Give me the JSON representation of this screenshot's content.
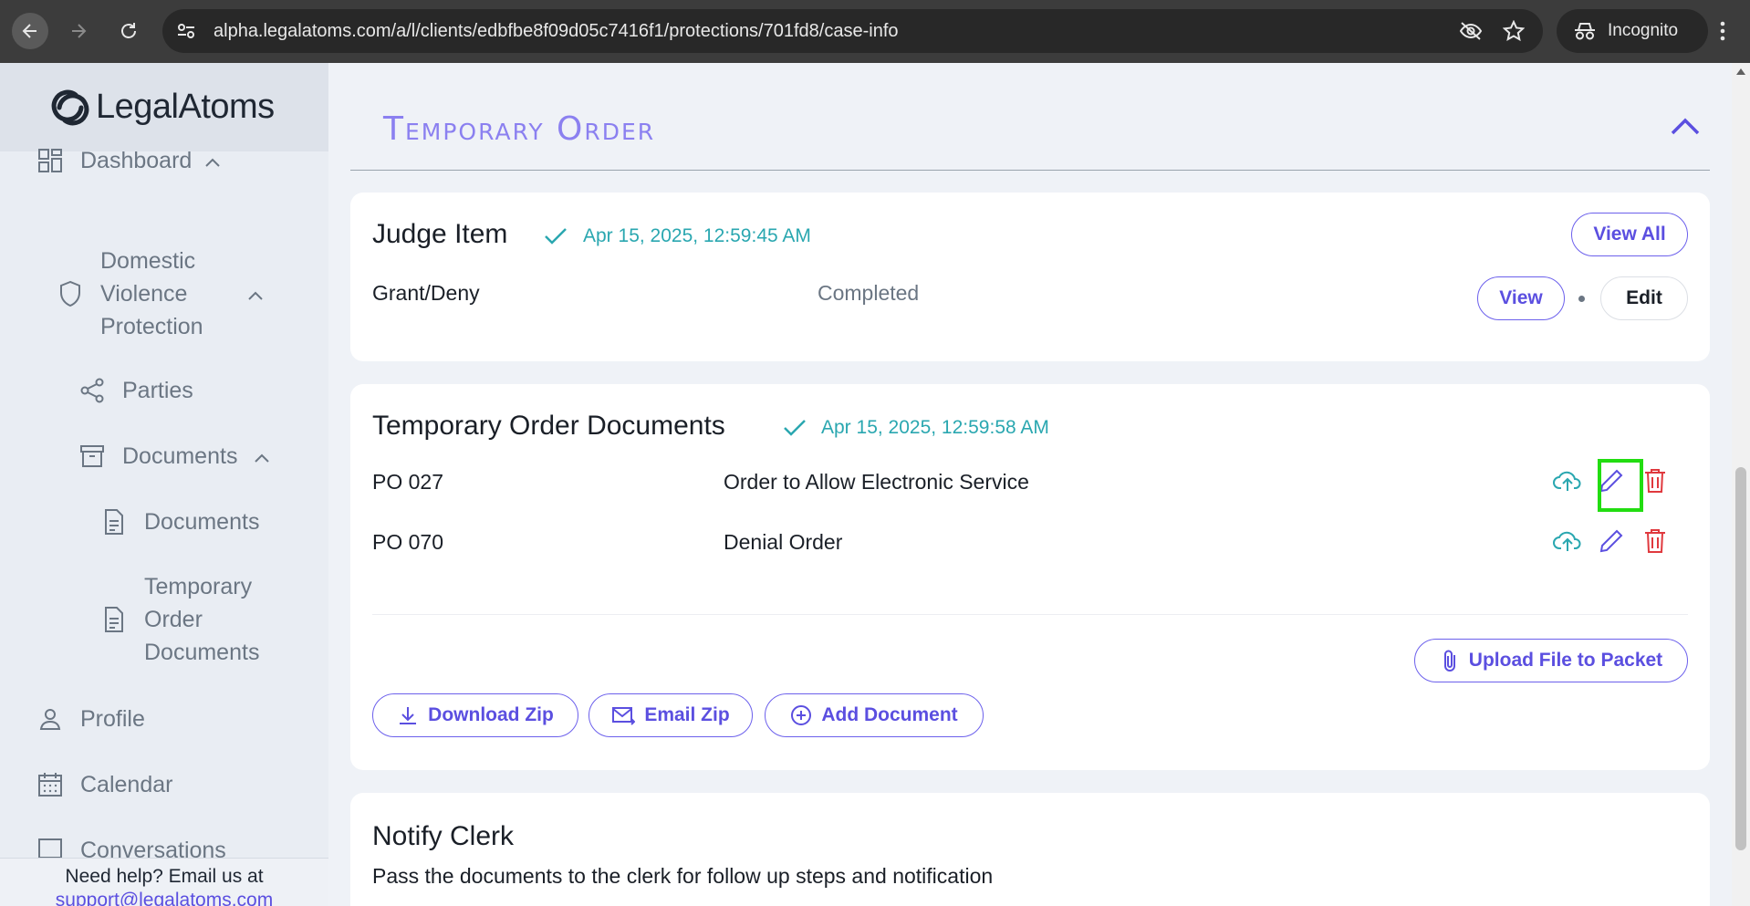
{
  "browser": {
    "url": "alpha.legalatoms.com/a/l/clients/edbfbe8f09d05c7416f1/protections/701fd8/case-info",
    "incognito_label": "Incognito"
  },
  "sidebar": {
    "logo_light": "Legal",
    "logo_bold": "Atoms",
    "items": [
      {
        "label": "Dashboard"
      },
      {
        "label_lines": [
          "Domestic",
          "Violence",
          "Protection"
        ]
      },
      {
        "label": "Parties"
      },
      {
        "label": "Documents"
      },
      {
        "label": "Documents"
      },
      {
        "label_lines": [
          "Temporary",
          "Order",
          "Documents"
        ]
      },
      {
        "label": "Profile"
      },
      {
        "label": "Calendar"
      },
      {
        "label": "Conversations"
      }
    ],
    "help_text": "Need help? Email us at",
    "help_email": "support@legalatoms.com"
  },
  "main": {
    "section_title": "Temporary Order",
    "judge_card": {
      "title": "Judge Item",
      "timestamp": "Apr 15, 2025, 12:59:45 AM",
      "view_all_label": "View All",
      "row_label": "Grant/Deny",
      "row_status": "Completed",
      "view_label": "View",
      "edit_label": "Edit"
    },
    "docs_card": {
      "title": "Temporary Order Documents",
      "timestamp": "Apr 15, 2025, 12:59:58 AM",
      "rows": [
        {
          "code": "PO 027",
          "name": "Order to Allow Electronic Service"
        },
        {
          "code": "PO 070",
          "name": "Denial Order"
        }
      ],
      "upload_label": "Upload File to Packet",
      "download_zip_label": "Download Zip",
      "email_zip_label": "Email Zip",
      "add_document_label": "Add Document"
    },
    "notify_card": {
      "title": "Notify Clerk",
      "description": "Pass the documents to the clerk for follow up steps and notification"
    }
  },
  "colors": {
    "accent": "#5b4fe0",
    "section_title": "#8b80f0",
    "timestamp": "#2aa7b0",
    "delete": "#e0393e",
    "highlight": "#22dd11"
  }
}
